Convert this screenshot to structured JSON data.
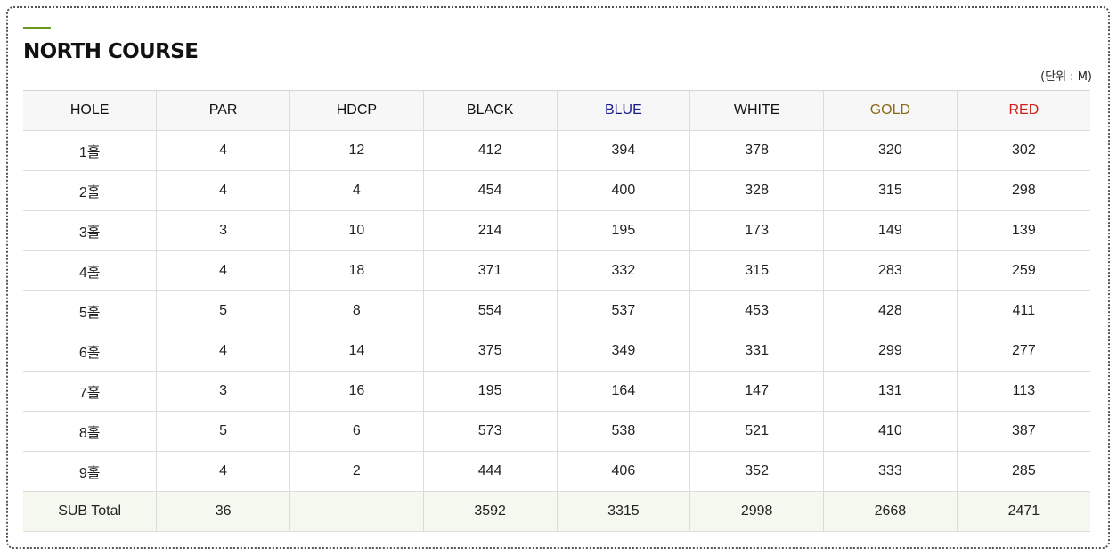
{
  "title": "NORTH COURSE",
  "unit_note": "(단위 : M)",
  "colors": {
    "accent": "#6a9a1f",
    "blue": "#1a1a8c",
    "gold": "#8a6a15",
    "red": "#d0201a"
  },
  "table": {
    "headers": [
      "HOLE",
      "PAR",
      "HDCP",
      "BLACK",
      "BLUE",
      "WHITE",
      "GOLD",
      "RED"
    ],
    "rows": [
      [
        "1홀",
        "4",
        "12",
        "412",
        "394",
        "378",
        "320",
        "302"
      ],
      [
        "2홀",
        "4",
        "4",
        "454",
        "400",
        "328",
        "315",
        "298"
      ],
      [
        "3홀",
        "3",
        "10",
        "214",
        "195",
        "173",
        "149",
        "139"
      ],
      [
        "4홀",
        "4",
        "18",
        "371",
        "332",
        "315",
        "283",
        "259"
      ],
      [
        "5홀",
        "5",
        "8",
        "554",
        "537",
        "453",
        "428",
        "411"
      ],
      [
        "6홀",
        "4",
        "14",
        "375",
        "349",
        "331",
        "299",
        "277"
      ],
      [
        "7홀",
        "3",
        "16",
        "195",
        "164",
        "147",
        "131",
        "113"
      ],
      [
        "8홀",
        "5",
        "6",
        "573",
        "538",
        "521",
        "410",
        "387"
      ],
      [
        "9홀",
        "4",
        "2",
        "444",
        "406",
        "352",
        "333",
        "285"
      ]
    ],
    "total": [
      "SUB Total",
      "36",
      "",
      "3592",
      "3315",
      "2998",
      "2668",
      "2471"
    ]
  }
}
